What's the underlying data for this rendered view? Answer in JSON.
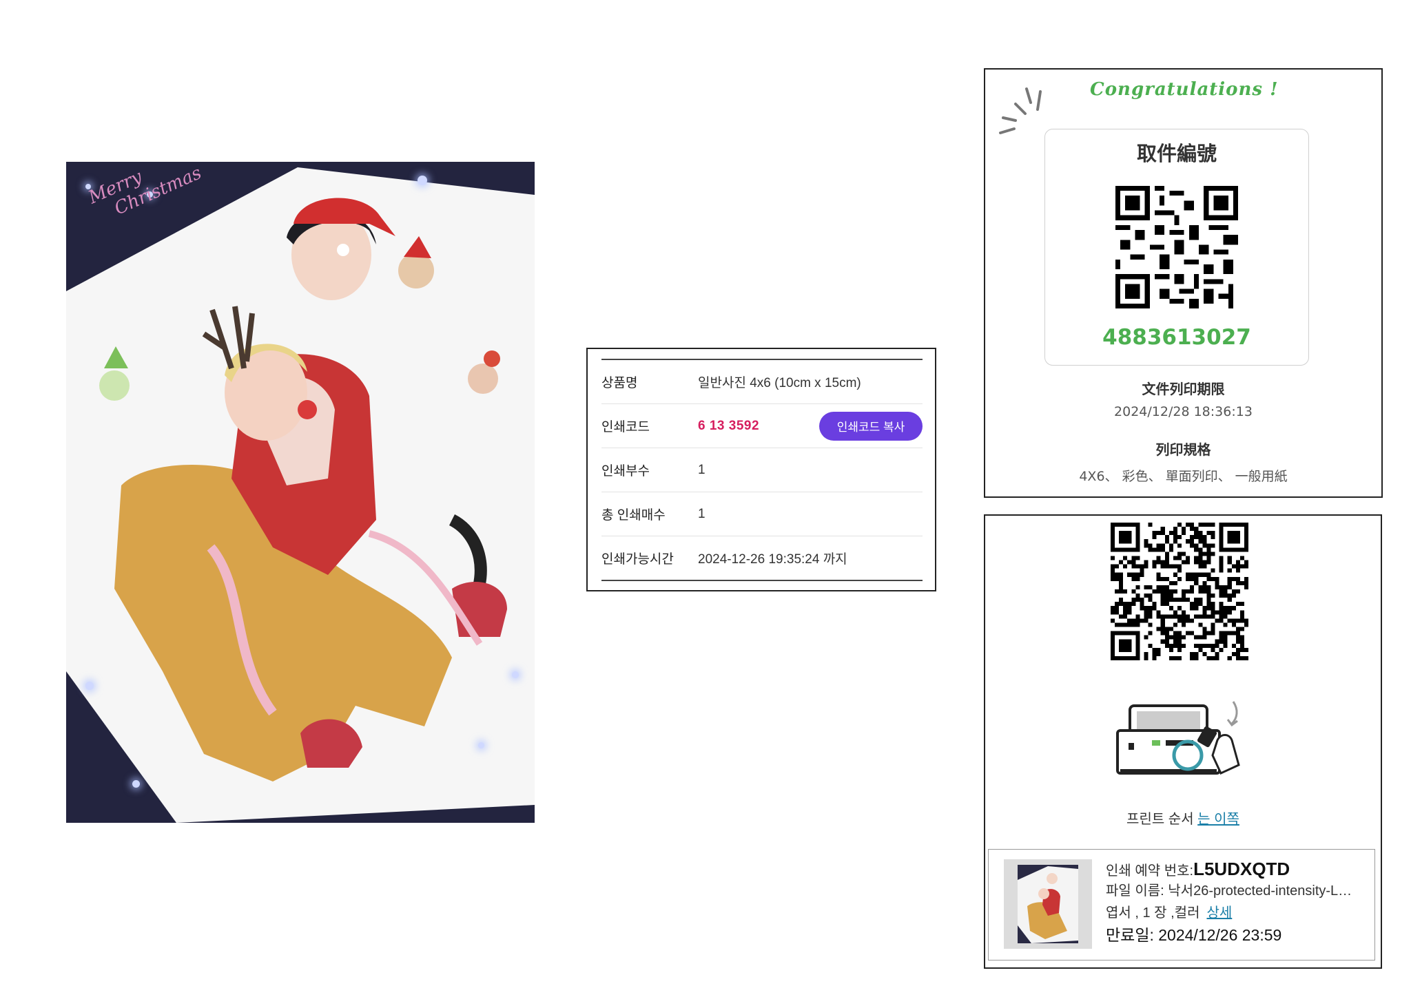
{
  "artwork": {
    "caption_line1": "Merry",
    "caption_line2": "Christmas"
  },
  "print_info": {
    "rows": [
      {
        "label": "상품명",
        "value": "일반사진 4x6 (10cm x 15cm)"
      },
      {
        "label": "인쇄코드",
        "value": "6 13 3592",
        "button": "인쇄코드 복사"
      },
      {
        "label": "인쇄부수",
        "value": "1"
      },
      {
        "label": "총 인쇄매수",
        "value": "1"
      },
      {
        "label": "인쇄가능시간",
        "value": "2024-12-26 19:35:24 까지"
      }
    ]
  },
  "pickup": {
    "congrats": "Congratulations !",
    "title": "取件編號",
    "number": "4883613027",
    "deadline_label": "文件列印期限",
    "deadline_value": "2024/12/28 18:36:13",
    "spec_label": "列印規格",
    "spec_value": "4X6、 彩色、 單面列印、 一般用紙",
    "accent_color": "#4caf50"
  },
  "reservation": {
    "print_order_text": "프린트 순서",
    "print_order_link": "는 이쪽",
    "number_label": "인쇄 예약 번호:",
    "number_value": "L5UDXQTD",
    "file_label": "파일 이름: 낙서26-protected-intensity-L…",
    "details_text": "엽서 , 1 장 ,컬러",
    "details_link": "상세",
    "expiry_label": "만료일:",
    "expiry_value": "2024/12/26 23:59"
  }
}
